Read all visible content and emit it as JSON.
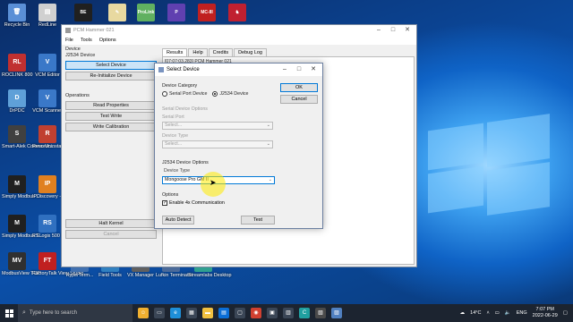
{
  "desktop": {
    "icons": [
      {
        "label": "Recycle Bin",
        "color": "#5a8fd6",
        "glyph": "🗑"
      },
      {
        "label": "RedLine",
        "color": "#d0d0d0",
        "glyph": "▤"
      },
      {
        "label": "RL800",
        "color": "#c03030",
        "glyph": "RL"
      },
      {
        "label": "ROCLINK 800",
        "color": "#c03030",
        "glyph": ""
      },
      {
        "label": "VCM Editor",
        "color": "#3a78c8",
        "glyph": "V"
      },
      {
        "label": "DrPDC",
        "color": "#5fa0d8",
        "glyph": "D"
      },
      {
        "label": "VCM Scanner",
        "color": "#3a78c8",
        "glyph": "V"
      },
      {
        "label": "Smart-Alek Communic...",
        "color": "#404040",
        "glyph": "S"
      },
      {
        "label": "Revo Uninstall...",
        "color": "#c04030",
        "glyph": "R"
      },
      {
        "label": "Simply Modbus ...",
        "color": "#202020",
        "glyph": "M"
      },
      {
        "label": "IPDiscovery - Shortcut",
        "color": "#e08020",
        "glyph": "IP"
      },
      {
        "label": "Simply Modbus T...",
        "color": "#202020",
        "glyph": "M"
      },
      {
        "label": "RSLogix 500 English",
        "color": "#3070c0",
        "glyph": "RS"
      },
      {
        "label": "ModbusView TCP",
        "color": "#303030",
        "glyph": "MV"
      },
      {
        "label": "FactoryTalk View Studio",
        "color": "#c02020",
        "glyph": "FT"
      }
    ],
    "bottom_icons": [
      {
        "label": "HyperTerm...",
        "color": "#4070b0"
      },
      {
        "label": "Field Tools",
        "color": "#3080c0"
      },
      {
        "label": "VX Manager",
        "color": "#606060"
      },
      {
        "label": "Lufkin Terminator",
        "color": "#4a6a9a"
      },
      {
        "label": "Streamlabs Desktop",
        "color": "#30a090"
      }
    ],
    "top_icons": [
      {
        "label": "",
        "color": "#202020",
        "glyph": "BE"
      },
      {
        "label": "",
        "color": "#e8d9a0",
        "glyph": "✎"
      },
      {
        "label": "",
        "color": "#60b060",
        "glyph": "ProLink"
      },
      {
        "label": "",
        "color": "#6040b0",
        "glyph": "P"
      },
      {
        "label": "",
        "color": "#c02020",
        "glyph": "MC-III"
      },
      {
        "label": "",
        "color": "#c02030",
        "glyph": "♞"
      }
    ]
  },
  "app": {
    "title": "PCM Hammer 021",
    "menu": [
      "File",
      "Tools",
      "Options"
    ],
    "device_label": "Device",
    "device_value": "J2534 Device",
    "buttons_top": [
      "Select Device",
      "Re-Initialize Device"
    ],
    "operations_label": "Operations",
    "buttons_ops": [
      "Read Properties",
      "Test Write",
      "Write Calibration"
    ],
    "buttons_bottom": [
      "Halt Kernel",
      "Cancel"
    ],
    "tabs": [
      "Results",
      "Help",
      "Credits",
      "Debug Log"
    ],
    "log_line": "[07:07:03.283] PCM Hammer 021"
  },
  "dialog": {
    "title": "Select Device",
    "category_label": "Device Category",
    "radio_serial": "Serial Port Device",
    "radio_j2534": "J2534 Device",
    "serial_group_label": "Serial Device Options",
    "serial_port_label": "Serial Port",
    "serial_port_value": "Select...",
    "device_type_label": "Device Type",
    "device_type_value": "Select...",
    "j2534_group_label": "J2534 Device Options",
    "j2534_type_label": "Device Type",
    "j2534_type_value": "Mongoose Pro GM II",
    "options_label": "Options",
    "enable_4x": "Enable 4x Communication",
    "ok": "OK",
    "cancel": "Cancel",
    "auto_detect": "Auto Detect",
    "test": "Test"
  },
  "taskbar": {
    "search_placeholder": "Type here to search",
    "temperature": "14°C",
    "language": "ENG",
    "time": "7:07 PM",
    "date": "2022-06-29"
  },
  "colors": {
    "accent": "#0078d7",
    "taskbar": "#1c2430"
  }
}
